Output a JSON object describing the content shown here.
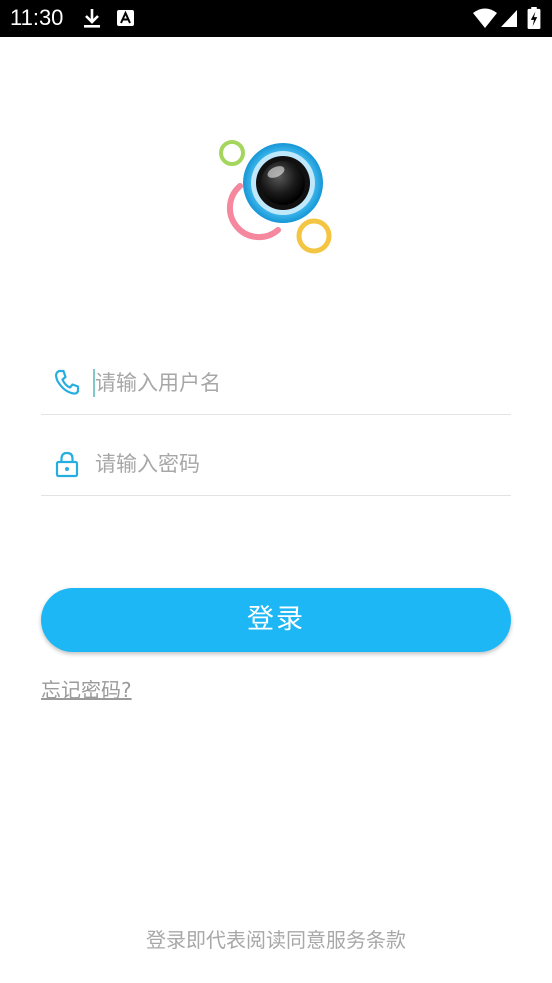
{
  "status_bar": {
    "time": "11:30",
    "icons": [
      "download-icon",
      "a11y-a-icon",
      "wifi-icon",
      "cell-signal-icon",
      "battery-charging-icon"
    ]
  },
  "login_form": {
    "username_placeholder": "请输入用户名",
    "password_placeholder": "请输入密码",
    "username_icon": "phone-icon",
    "password_icon": "lock-icon",
    "login_label": "登录",
    "forgot_password_label": "忘记密码?"
  },
  "footer": {
    "terms_text": "登录即代表阅读同意服务条款"
  },
  "colors": {
    "accent": "#1eb7f5",
    "icon": "#27aee0",
    "placeholder": "#a7a7a7",
    "divider": "#e3e3e3"
  }
}
